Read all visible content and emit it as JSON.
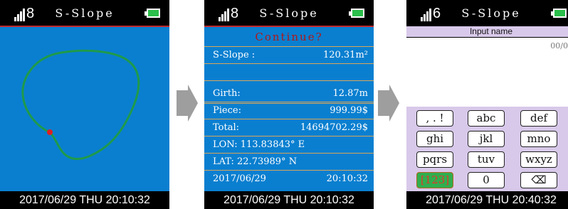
{
  "screens": [
    {
      "status": {
        "signal": "8",
        "title": "S-Slope"
      },
      "footer": "2017/06/29  THU 20:10:32"
    },
    {
      "status": {
        "signal": "8",
        "title": "S-Slope"
      },
      "header": "Continue?",
      "rows": [
        {
          "label": "S-Slope :",
          "value": "120.31m²"
        },
        {
          "label": "",
          "value": ""
        },
        {
          "label": "Girth:",
          "value": "12.87m"
        },
        {
          "label": "Piece:",
          "value": "999.99$"
        },
        {
          "label": "Total:",
          "value": "14694702.29$"
        },
        {
          "label": "LON: 113.83843° E",
          "value": ""
        },
        {
          "label": "LAT: 22.73989° N",
          "value": ""
        },
        {
          "label": "2017/06/29",
          "value": "20:10:32"
        }
      ],
      "footer": "2017/06/29  THU 20:10:32"
    },
    {
      "status": {
        "signal": "6",
        "title": "S-Slope"
      },
      "input_title": "Input name",
      "char_count": "00/04",
      "keys": [
        ", . !",
        "abc",
        "def",
        "ghi",
        "jkl",
        "mno",
        "pqrs",
        "tuv",
        "wxyz",
        "[123]",
        "0",
        "⌫"
      ],
      "footer": "2017/06/29  THU 20:40:32"
    }
  ],
  "colors": {
    "screen_blue": "#0a7fd0",
    "trace_green": "#1f9a4a",
    "start_point_red": "#e02020",
    "keypad_bg": "#d8c9ea",
    "divider_red": "#c0282b"
  }
}
